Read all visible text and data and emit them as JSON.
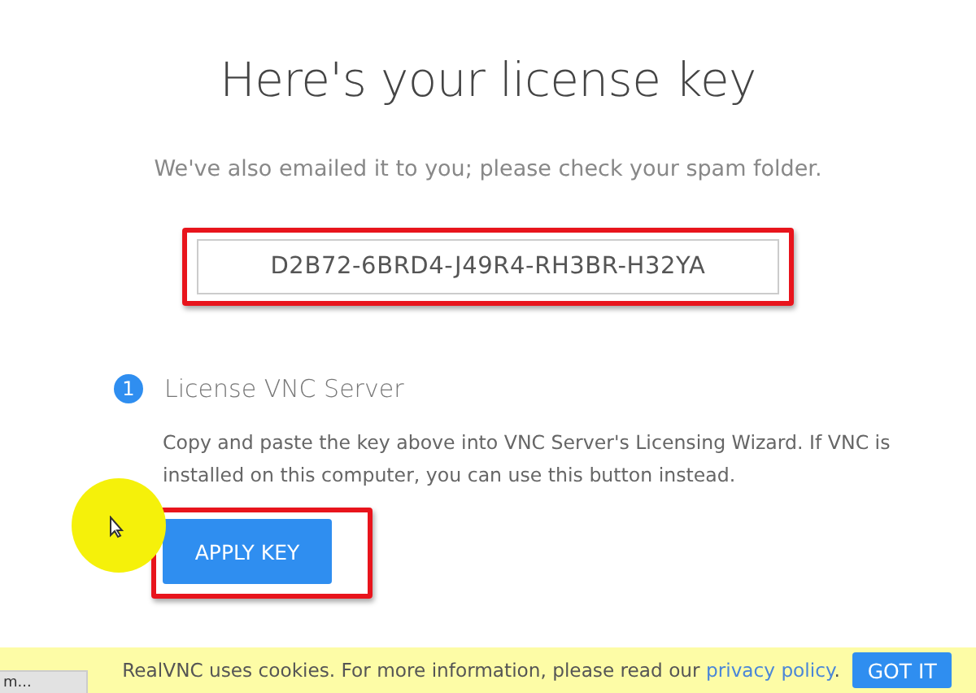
{
  "title": "Here's your license key",
  "subtitle": "We've also emailed it to you; please check your spam folder.",
  "license_key": {
    "value": "D2B72-6BRD4-J49R4-RH3BR-H32YA",
    "highlighted": true
  },
  "steps": [
    {
      "number": "1",
      "title": "License VNC Server",
      "text": "Copy and paste the key above into VNC Server's Licensing Wizard. If VNC is installed on this computer, you can use this button instead.",
      "button": {
        "label": "APPLY KEY",
        "highlighted": true
      }
    }
  ],
  "cookie_bar": {
    "text": "RealVNC uses cookies. For more information, please read our",
    "link": "privacy policy",
    "after_link": ".",
    "button": "GOT IT"
  },
  "status_bar": {
    "text": "m..."
  }
}
